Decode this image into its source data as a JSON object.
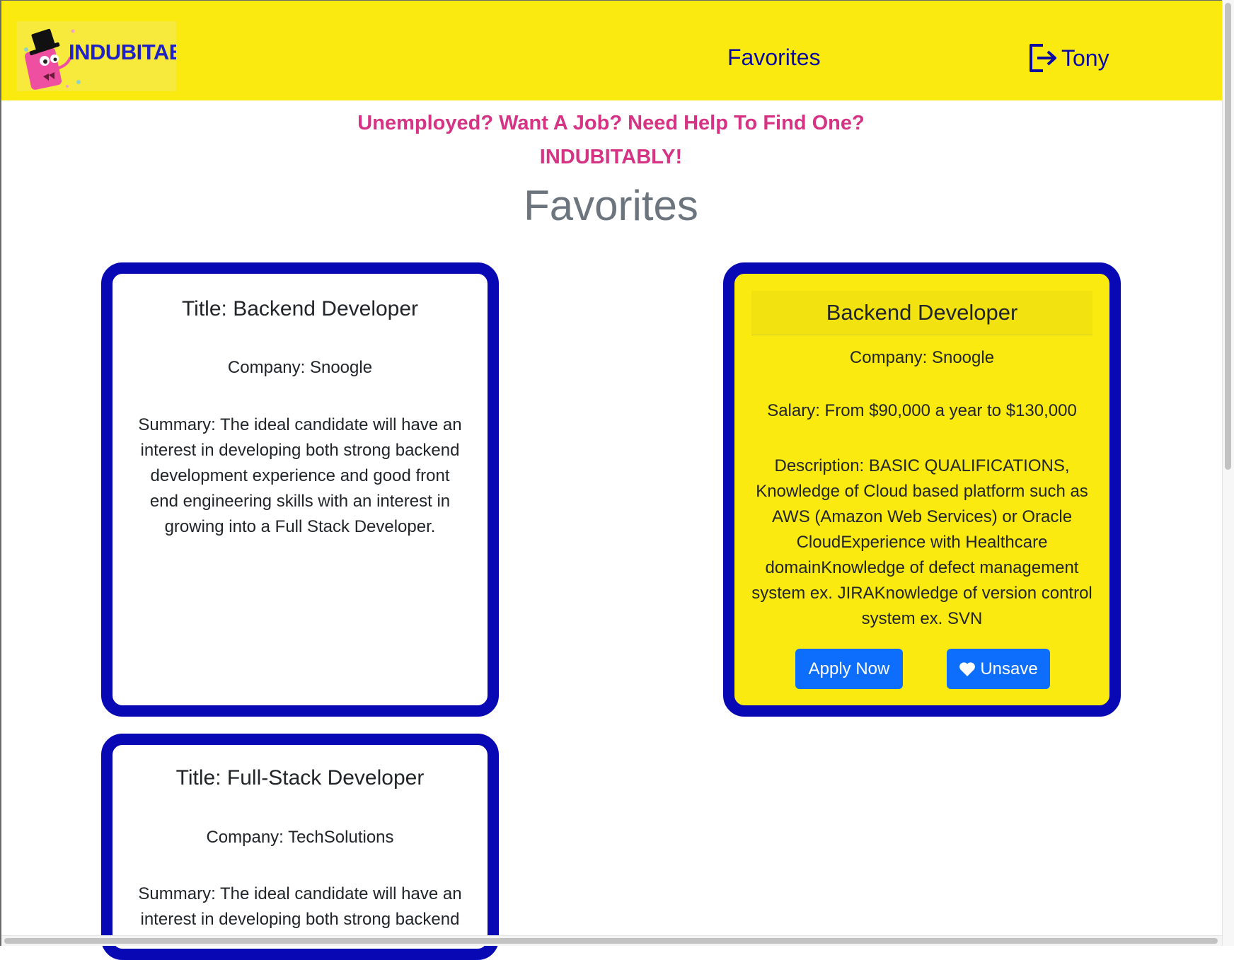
{
  "navbar": {
    "logo_text": "INDUBITABLY",
    "favorites_link": "Favorites",
    "user_name": "Tony",
    "logout_icon": "logout-arrow-icon"
  },
  "tagline": {
    "line1": "Unemployed? Want A Job? Need Help To Find One?",
    "line2": "INDUBITABLY!"
  },
  "page_title": "Favorites",
  "colors": {
    "navbar_bg": "#fbea10",
    "card_border": "#0808b5",
    "tagline": "#d63384",
    "button": "#0d6efd"
  },
  "cards": [
    {
      "title": "Title: Backend Developer",
      "company": "Company: Snoogle",
      "summary": "Summary: The ideal candidate will have an interest in developing both strong backend development experience and good front end engineering skills with an interest in growing into a Full Stack Developer."
    },
    {
      "title": "Title: Full-Stack Developer",
      "company": "Company: TechSolutions",
      "summary": "Summary: The ideal candidate will have an interest in developing both strong backend"
    }
  ],
  "detail_card": {
    "title": "Backend Developer",
    "company": "Company: Snoogle",
    "salary": "Salary: From $90,000 a year to $130,000",
    "description": "Description: BASIC QUALIFICATIONS, Knowledge of Cloud based platform such as AWS (Amazon Web Services) or Oracle CloudExperience with Healthcare domainKnowledge of defect management system ex. JIRAKnowledge of version control system ex. SVN",
    "apply_label": "Apply Now",
    "unsave_label": "Unsave",
    "unsave_icon": "heart-icon"
  }
}
